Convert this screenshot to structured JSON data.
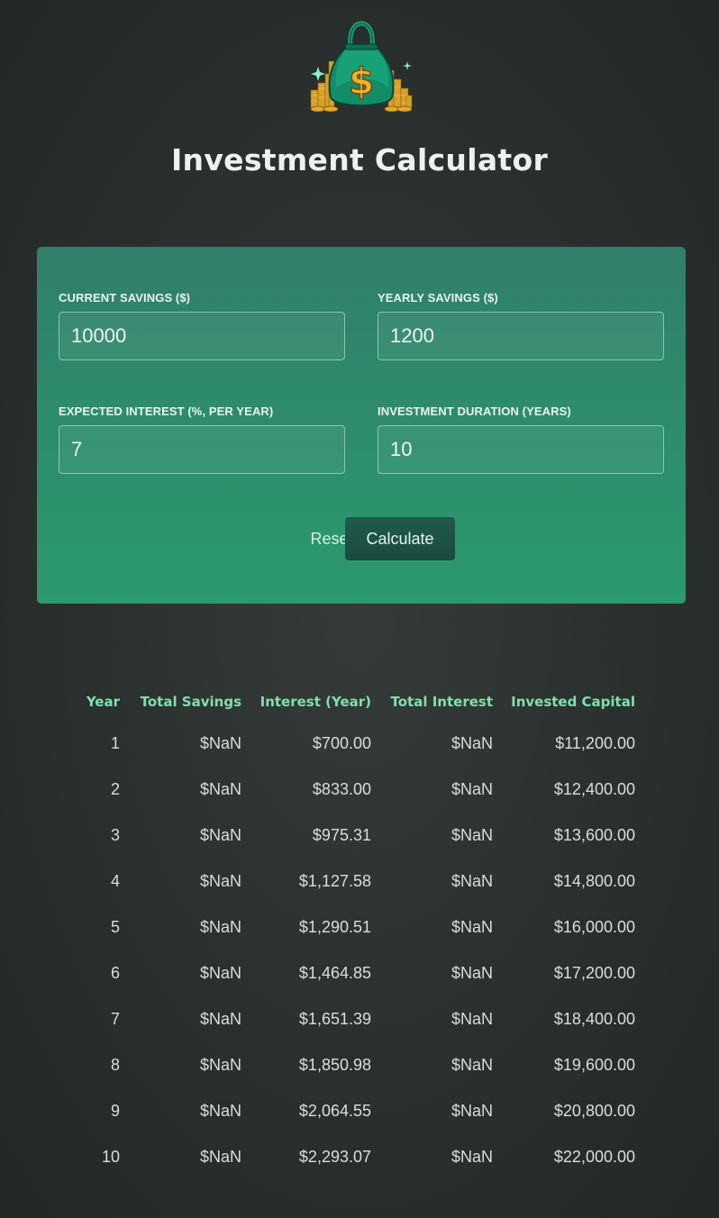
{
  "header": {
    "logo": "money-bag-with-dollar-sign-and-coins",
    "title": "Investment Calculator"
  },
  "form": {
    "current_savings": {
      "label": "CURRENT SAVINGS ($)",
      "value": "10000"
    },
    "yearly_savings": {
      "label": "YEARLY SAVINGS ($)",
      "value": "1200"
    },
    "expected_interest": {
      "label": "EXPECTED INTEREST (%, PER YEAR)",
      "value": "7"
    },
    "duration": {
      "label": "INVESTMENT DURATION (YEARS)",
      "value": "10"
    },
    "reset_label": "Reset",
    "calculate_label": "Calculate"
  },
  "table": {
    "headers": [
      "Year",
      "Total Savings",
      "Interest (Year)",
      "Total Interest",
      "Invested Capital"
    ],
    "rows": [
      [
        "1",
        "$NaN",
        "$700.00",
        "$NaN",
        "$11,200.00"
      ],
      [
        "2",
        "$NaN",
        "$833.00",
        "$NaN",
        "$12,400.00"
      ],
      [
        "3",
        "$NaN",
        "$975.31",
        "$NaN",
        "$13,600.00"
      ],
      [
        "4",
        "$NaN",
        "$1,127.58",
        "$NaN",
        "$14,800.00"
      ],
      [
        "5",
        "$NaN",
        "$1,290.51",
        "$NaN",
        "$16,000.00"
      ],
      [
        "6",
        "$NaN",
        "$1,464.85",
        "$NaN",
        "$17,200.00"
      ],
      [
        "7",
        "$NaN",
        "$1,651.39",
        "$NaN",
        "$18,400.00"
      ],
      [
        "8",
        "$NaN",
        "$1,850.98",
        "$NaN",
        "$19,600.00"
      ],
      [
        "9",
        "$NaN",
        "$2,064.55",
        "$NaN",
        "$20,800.00"
      ],
      [
        "10",
        "$NaN",
        "$2,293.07",
        "$NaN",
        "$22,000.00"
      ]
    ]
  },
  "colors": {
    "background": "#2a302e",
    "card_top": "#307f6c",
    "card_bottom": "#2b9a6d",
    "table_header": "#7fe0ad",
    "button_dark": "#1d5243"
  }
}
